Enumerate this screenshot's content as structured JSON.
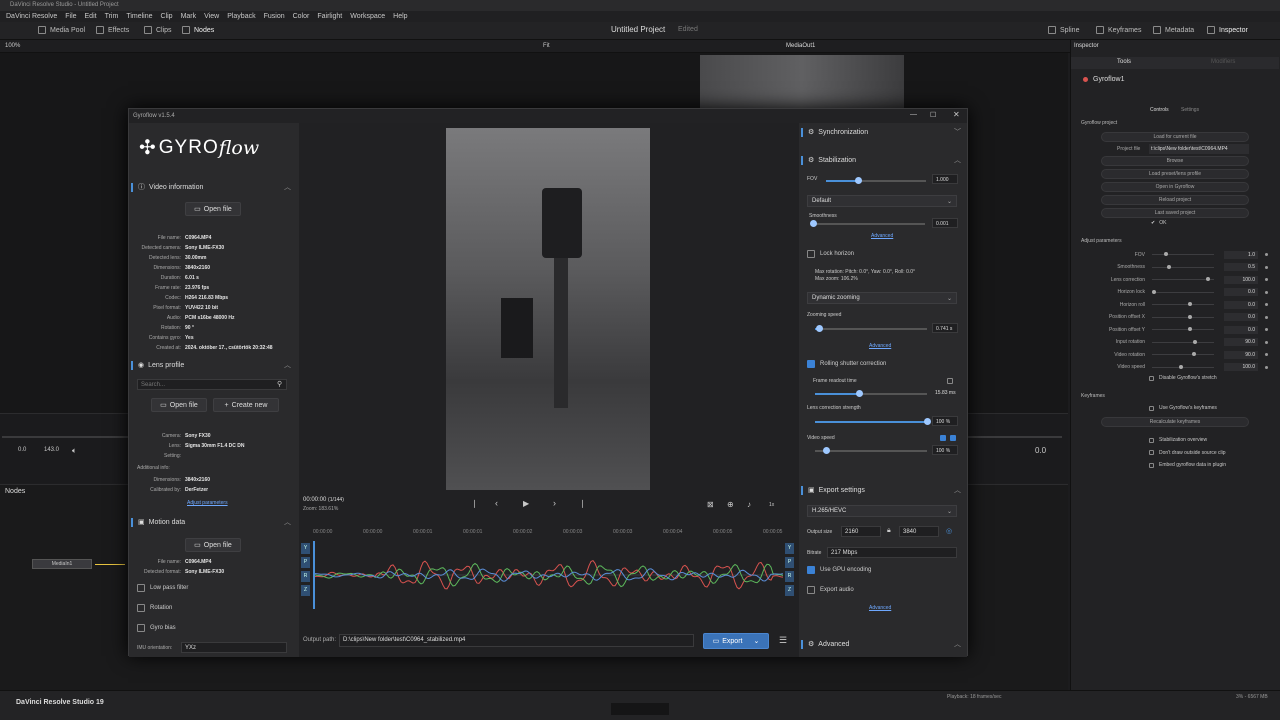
{
  "window": {
    "title": "DaVinci Resolve Studio - Untitled Project"
  },
  "menu": [
    "DaVinci Resolve",
    "File",
    "Edit",
    "Trim",
    "Timeline",
    "Clip",
    "Mark",
    "View",
    "Playback",
    "Fusion",
    "Color",
    "Fairlight",
    "Workspace",
    "Help"
  ],
  "toolbar": {
    "media_pool": "Media Pool",
    "effects": "Effects",
    "clips": "Clips",
    "nodes": "Nodes",
    "project_title": "Untitled Project",
    "edited": "Edited",
    "spline": "Spline",
    "keyframes": "Keyframes",
    "metadata": "Metadata",
    "inspector": "Inspector"
  },
  "viewerbar": {
    "zoom": "100%",
    "fit": "Fit",
    "output": "MediaOut1",
    "inspector_title": "Inspector"
  },
  "timeline": {
    "tc_a": "0.0",
    "tc_b": "143.0",
    "tc_c": "0.0"
  },
  "nodes": {
    "title": "Nodes",
    "node1": "MediaIn1"
  },
  "status": {
    "app": "DaVinci Resolve Studio 19",
    "playback": "Playback: 18 frames/sec",
    "mem": "3% - 6567 MB"
  },
  "inspector": {
    "tabs": {
      "tools": "Tools",
      "modifiers": "Modifiers"
    },
    "node": "Gyroflow1",
    "subtabs": {
      "controls": "Controls",
      "settings": "Settings"
    },
    "project_section": "Gyroflow project",
    "buttons": [
      "Load for current file",
      "Browse",
      "Load preset/lens profile",
      "Open in Gyroflow",
      "Reload project",
      "Last saved project"
    ],
    "project_file_label": "Project file",
    "project_file": "t:\\clips\\New folder\\test\\C0964.MP4",
    "ok": "OK",
    "adjust_section": "Adjust parameters",
    "params": [
      {
        "k": "FOV",
        "v": "1.0"
      },
      {
        "k": "Smoothness",
        "v": "0.5"
      },
      {
        "k": "Lens correction",
        "v": "100.0"
      },
      {
        "k": "Horizon lock",
        "v": "0.0"
      },
      {
        "k": "Horizon roll",
        "v": "0.0"
      },
      {
        "k": "Position offset X",
        "v": "0.0"
      },
      {
        "k": "Position offset Y",
        "v": "0.0"
      },
      {
        "k": "Input rotation",
        "v": "90.0"
      },
      {
        "k": "Video rotation",
        "v": "90.0"
      },
      {
        "k": "Video speed",
        "v": "100.0"
      }
    ],
    "disable_stretch": "Disable Gyroflow's stretch",
    "keyframes_section": "Keyframes",
    "use_keyframes": "Use Gyroflow's keyframes",
    "recalc": "Recalculate keyframes",
    "opts": [
      "Stabilization overview",
      "Don't draw outside source clip",
      "Embed gyroflow data in plugin"
    ]
  },
  "gyroflow": {
    "title": "Gyroflow v1.5.4",
    "logo_a": "GYRO",
    "logo_b": "flow",
    "video_info": {
      "title": "Video information",
      "open_file": "Open file",
      "rows": [
        {
          "k": "File name:",
          "v": "C0964.MP4"
        },
        {
          "k": "Detected camera:",
          "v": "Sony ILME-FX30"
        },
        {
          "k": "Detected lens:",
          "v": "30.00mm"
        },
        {
          "k": "Dimensions:",
          "v": "3840x2160"
        },
        {
          "k": "Duration:",
          "v": "6.01 s"
        },
        {
          "k": "Frame rate:",
          "v": "23.976 fps"
        },
        {
          "k": "Codec:",
          "v": "H264 216.83 Mbps"
        },
        {
          "k": "Pixel format:",
          "v": "YUV422 10 bit"
        },
        {
          "k": "Audio:",
          "v": "PCM s16be 48000 Hz"
        },
        {
          "k": "Rotation:",
          "v": "90 °"
        },
        {
          "k": "Contains gyro:",
          "v": "Yes"
        },
        {
          "k": "Created at:",
          "v": "2024. október 17., csütörtök 20:32:48"
        }
      ]
    },
    "lens": {
      "title": "Lens profile",
      "search": "Search...",
      "open_file": "Open file",
      "create_new": "Create new",
      "camera_k": "Camera:",
      "camera_v": "Sony FX30",
      "lens_k": "Lens:",
      "lens_v": "Sigma 30mm F1.4 DC DN",
      "setting_k": "Setting:",
      "addinfo_k": "Additional info:",
      "dim_k": "Dimensions:",
      "dim_v": "3840x2160",
      "cal_k": "Calibrated by:",
      "cal_v": "DerFetzer",
      "adjust": "Adjust parameters"
    },
    "motion": {
      "title": "Motion data",
      "open_file": "Open file",
      "file_k": "File name:",
      "file_v": "C0964.MP4",
      "fmt_k": "Detected format:",
      "fmt_v": "Sony ILME-FX30",
      "lowpass": "Low pass filter",
      "rotation": "Rotation",
      "gyro_bias": "Gyro bias",
      "imu_k": "IMU orientation:",
      "imu_v": "YXz"
    },
    "player": {
      "time": "00:00:00",
      "frames": "(1/144)",
      "zoom": "Zoom: 183.61%",
      "speed": "1x",
      "ticks": [
        "00:00:00",
        "00:00:00",
        "00:00:01",
        "00:00:01",
        "00:00:02",
        "00:00:03",
        "00:00:03",
        "00:00:04",
        "00:00:05",
        "00:00:05"
      ],
      "axes": [
        "Y",
        "P",
        "R",
        "Z"
      ]
    },
    "output": {
      "label": "Output path:",
      "path": "D:\\clips\\New folder\\test\\C0964_stabilized.mp4",
      "export": "Export"
    },
    "sync": {
      "title": "Synchronization"
    },
    "stab": {
      "title": "Stabilization",
      "fov_label": "FOV",
      "fov_value": 1.0,
      "fov_text": "1.000",
      "method": "Default",
      "smooth_label": "Smoothness",
      "smooth_value": 0.001,
      "smooth_text": "0.001",
      "advanced": "Advanced",
      "lock_horizon": "Lock horizon",
      "max_rot": "Max rotation: Pitch: 0.0°, Yaw: 0.0°, Roll: 0.0°",
      "max_zoom": "Max zoom: 106.2%",
      "dyn_zoom": "Dynamic zooming",
      "zoom_speed_label": "Zooming speed",
      "zoom_speed_value": 0.741,
      "zoom_speed_text": "0.741 s",
      "rs": "Rolling shutter correction",
      "readout_label": "Frame readout time",
      "readout_value": 15.83,
      "readout_text": "15.83 ms",
      "lenscorr_label": "Lens correction strength",
      "lenscorr_value": 100,
      "lenscorr_text": "100 %",
      "vspeed_label": "Video speed",
      "vspeed_value": 100,
      "vspeed_text": "100 %"
    },
    "export": {
      "title": "Export settings",
      "codec": "H.265/HEVC",
      "size_label": "Output size",
      "w": "2160",
      "h": "3840",
      "bitrate_label": "Bitrate",
      "bitrate": "217 Mbps",
      "gpu": "Use GPU encoding",
      "audio": "Export audio",
      "advanced": "Advanced"
    },
    "advanced": {
      "title": "Advanced"
    }
  },
  "colors": {
    "accent": "#4a90d9",
    "gyro_red": "#d9534f",
    "gyro_green": "#5cb85c",
    "gyro_blue": "#5b8fd9"
  }
}
